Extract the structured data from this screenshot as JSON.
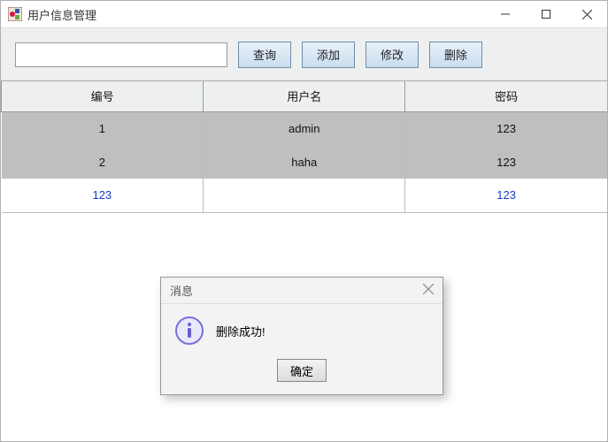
{
  "window": {
    "title": "用户信息管理"
  },
  "toolbar": {
    "search_value": "",
    "search_placeholder": "",
    "buttons": {
      "query": "查询",
      "add": "添加",
      "edit": "修改",
      "delete": "删除"
    }
  },
  "table": {
    "columns": {
      "id": "编号",
      "username": "用户名",
      "password": "密码"
    },
    "rows": [
      {
        "id": "1",
        "username": "admin",
        "password": "123",
        "selected": true
      },
      {
        "id": "2",
        "username": "haha",
        "password": "123",
        "selected": true
      },
      {
        "id": "123",
        "username": "",
        "password": "123",
        "selected": false
      }
    ]
  },
  "dialog": {
    "title": "消息",
    "message": "删除成功!",
    "ok_label": "确定"
  }
}
